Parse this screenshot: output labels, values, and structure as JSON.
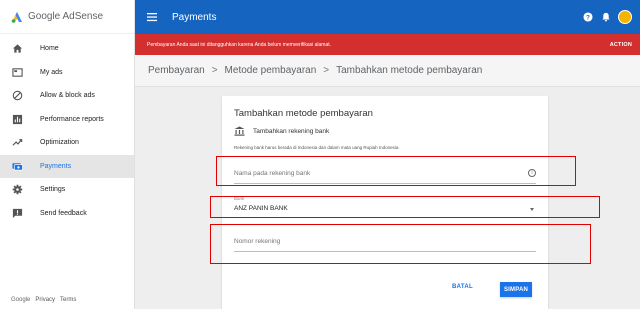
{
  "brand": {
    "name": "Google AdSense"
  },
  "sidebar": {
    "items": [
      {
        "label": "Home",
        "icon": "home-icon",
        "active": false
      },
      {
        "label": "My ads",
        "icon": "ads-icon",
        "active": false
      },
      {
        "label": "Allow & block ads",
        "icon": "block-icon",
        "active": false
      },
      {
        "label": "Performance reports",
        "icon": "bar-chart-icon",
        "active": false
      },
      {
        "label": "Optimization",
        "icon": "trending-icon",
        "active": false
      },
      {
        "label": "Payments",
        "icon": "payments-icon",
        "active": true
      },
      {
        "label": "Settings",
        "icon": "gear-icon",
        "active": false
      },
      {
        "label": "Send feedback",
        "icon": "feedback-icon",
        "active": false
      }
    ],
    "footer": {
      "google": "Google",
      "privacy": "Privacy",
      "terms": "Terms"
    }
  },
  "topbar": {
    "title": "Payments",
    "color": "#1565c0"
  },
  "banner": {
    "text": "Pembayaran Anda saat ini ditangguhkan karena Anda belum memverifikasi alamat.",
    "action": "ACTION",
    "color": "#d32f2f"
  },
  "breadcrumb": {
    "items": [
      "Pembayaran",
      "Metode pembayaran",
      "Tambahkan metode pembayaran"
    ],
    "separator": ">"
  },
  "card": {
    "title": "Tambahkan metode pembayaran",
    "bank_label": "Tambahkan rekening bank",
    "info": "Rekening bank harus berada di Indonesia dan dalam mata uang Rupiah Indonesia.",
    "name_field": {
      "placeholder": "Nama pada rekening bank",
      "value": ""
    },
    "bank_field": {
      "label": "Bank",
      "value": "ANZ PANIN BANK"
    },
    "account_field": {
      "placeholder": "Nomor rekening",
      "value": ""
    },
    "cancel_label": "BATAL",
    "save_label": "SIMPAN"
  },
  "colors": {
    "accent": "#1a73e8",
    "annotation": "#e00000"
  }
}
